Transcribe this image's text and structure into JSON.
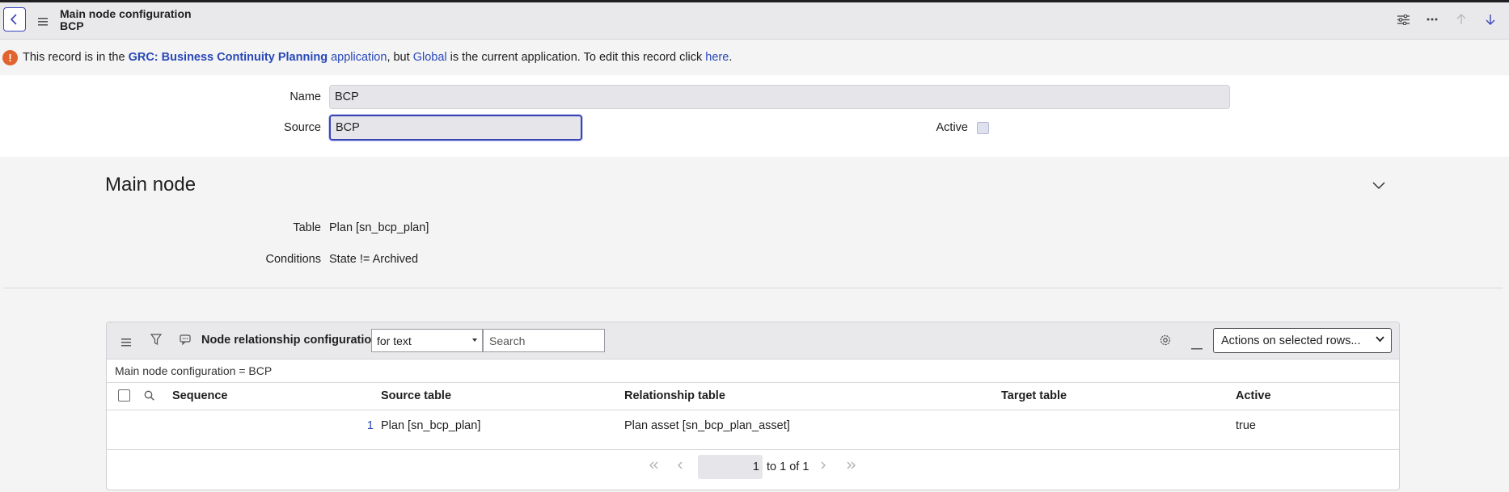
{
  "header": {
    "title": "Main node configuration",
    "subtitle": "BCP",
    "icons": [
      "back-icon",
      "menu-icon",
      "settings-sliders-icon",
      "more-icon",
      "arrow-up-icon",
      "arrow-down-icon"
    ]
  },
  "notice": {
    "text1": "This record is in the ",
    "app_name": "GRC: Business Continuity Planning",
    "text2": " application",
    "text3": ", but ",
    "global_link": "Global",
    "text4": " is the current application. To edit this record click ",
    "here_link": "here",
    "text5": "."
  },
  "form": {
    "name_label": "Name",
    "name_value": "BCP",
    "source_label": "Source",
    "source_value": "BCP",
    "active_label": "Active"
  },
  "main_node": {
    "title": "Main node",
    "table_label": "Table",
    "table_value": "Plan [sn_bcp_plan]",
    "conditions_label": "Conditions",
    "conditions_value": "State != Archived"
  },
  "related_list": {
    "title": "Node relationship configurations",
    "search_field_select": "for text",
    "search_placeholder": "Search",
    "actions_label": "Actions on selected rows...",
    "breadcrumb": "Main node configuration = BCP",
    "columns": [
      "Sequence",
      "Source table",
      "Relationship table",
      "Target table",
      "Active"
    ],
    "rows": [
      {
        "sequence": "1",
        "source_table": "Plan [sn_bcp_plan]",
        "relationship_table": "Plan asset [sn_bcp_plan_asset]",
        "target_table": "",
        "active": "true"
      }
    ],
    "pager": {
      "page_value": "1",
      "range_text": "to 1 of 1"
    }
  },
  "colors": {
    "accent": "#3a46b8",
    "link": "#2948b8",
    "warning": "#e1632e"
  }
}
